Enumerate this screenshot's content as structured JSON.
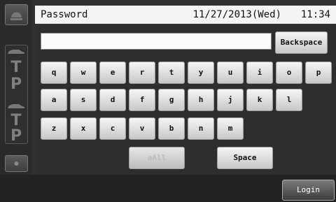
{
  "header": {
    "title": "Password",
    "date": "11/27/2013(Wed)",
    "time": "11:34"
  },
  "password_field": {
    "value": ""
  },
  "keyboard": {
    "backspace_label": "Backspace",
    "row1": [
      "q",
      "w",
      "e",
      "r",
      "t",
      "y",
      "u",
      "i",
      "o",
      "p"
    ],
    "row2": [
      "a",
      "s",
      "d",
      "f",
      "g",
      "h",
      "j",
      "k",
      "l"
    ],
    "row3": [
      "z",
      "x",
      "c",
      "v",
      "b",
      "n",
      "m"
    ],
    "case_label": "aAll",
    "space_label": "Space"
  },
  "footer": {
    "login_label": "Login"
  },
  "side_rail": {
    "icons": [
      "top-indicator-icon",
      "car-icon",
      "t-icon",
      "p-icon",
      "car-icon",
      "t-icon",
      "p-icon",
      "dot-icon"
    ],
    "letters": [
      "T",
      "P",
      "T",
      "P"
    ]
  }
}
